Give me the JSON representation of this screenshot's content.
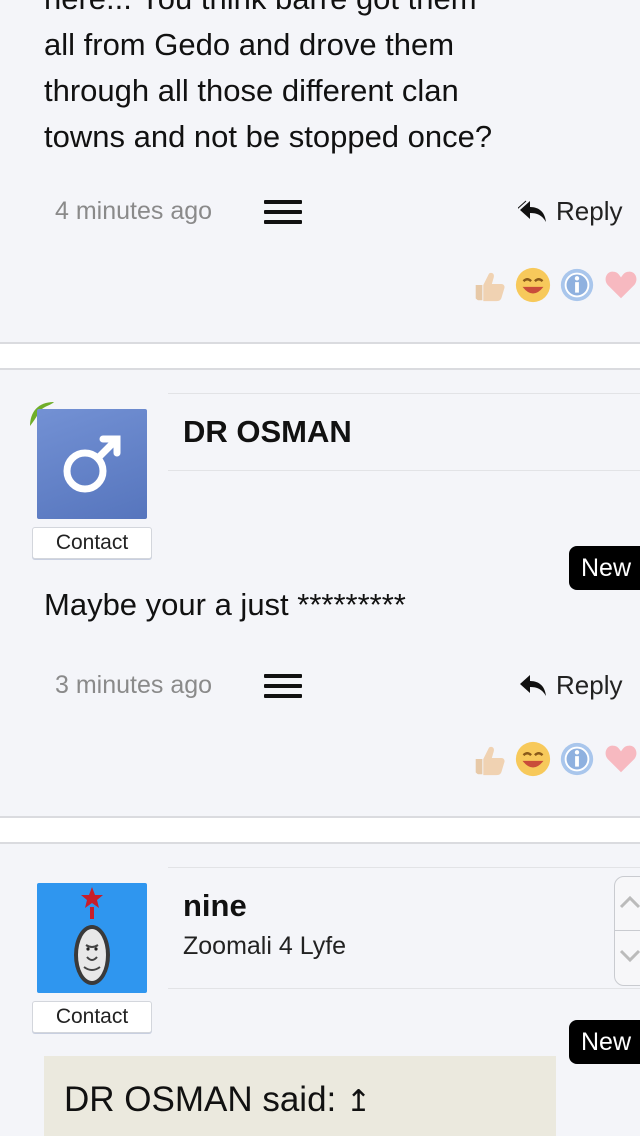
{
  "post1": {
    "text_lines": [
      "here... You think barre got them",
      "all from Gedo and drove them",
      "through all those different clan",
      "towns and not be stopped once?"
    ],
    "time": "4 minutes ago",
    "reply_label": "Reply"
  },
  "post2": {
    "author": "DR OSMAN",
    "avatar_symbol": "♂",
    "contact_label": "Contact",
    "new_badge": "New",
    "text": "Maybe your a just *********",
    "time": "3 minutes ago",
    "reply_label": "Reply"
  },
  "post3": {
    "author": "nine",
    "user_title": "Zoomali 4 Lyfe",
    "contact_label": "Contact",
    "new_badge": "New",
    "quote_header": "DR OSMAN said:",
    "quote_arrow": "↥"
  },
  "icons": [
    "like-icon",
    "laugh-icon",
    "info-icon",
    "love-icon",
    "menu-icon",
    "reply-icon",
    "male-symbol-icon",
    "lion-emblem-icon",
    "scroll-up-icon",
    "scroll-down-icon"
  ],
  "colors": {
    "avatar_blue": "#5f7fc8",
    "avatar_sky": "#2f96ef",
    "leaf_green": "#6fae2a",
    "badge_black": "#000000"
  }
}
